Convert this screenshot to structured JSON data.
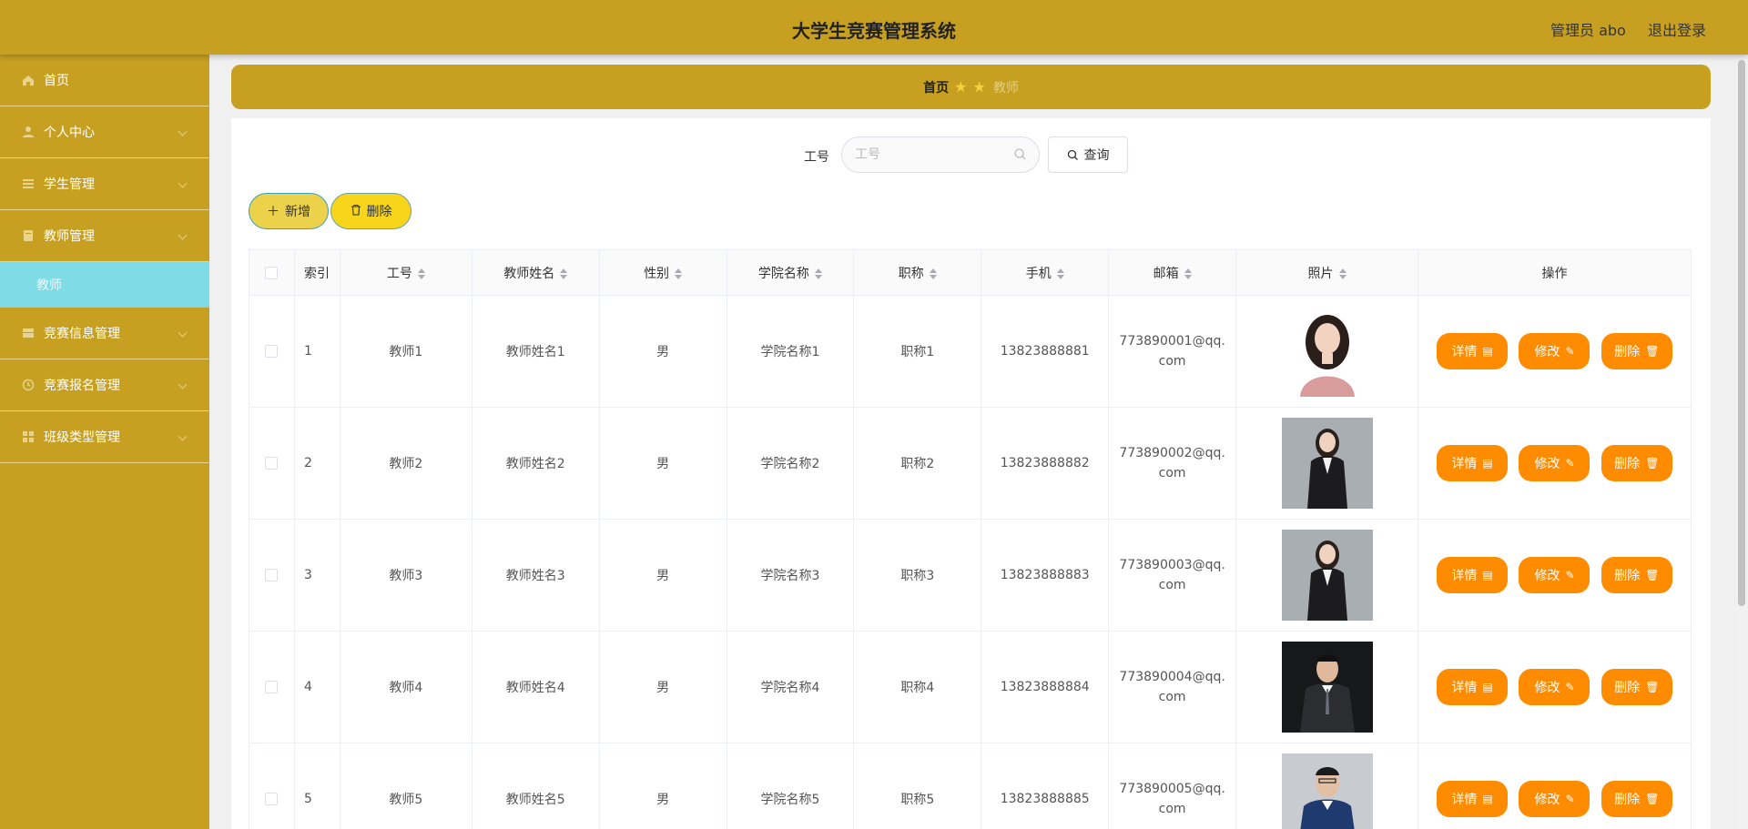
{
  "header": {
    "title": "大学生竞赛管理系统",
    "admin": "管理员 abo",
    "logout": "退出登录"
  },
  "sidebar": {
    "items": [
      {
        "label": "首页",
        "icon": "home-icon"
      },
      {
        "label": "个人中心",
        "icon": "user-icon"
      },
      {
        "label": "学生管理",
        "icon": "list-icon"
      },
      {
        "label": "教师管理",
        "icon": "book-icon"
      },
      {
        "label": "竞赛信息管理",
        "icon": "table-icon"
      },
      {
        "label": "竞赛报名管理",
        "icon": "clock-icon"
      },
      {
        "label": "班级类型管理",
        "icon": "grid-icon"
      }
    ],
    "sub_item": "教师"
  },
  "breadcrumb": {
    "home": "首页",
    "current": "教师"
  },
  "search": {
    "label": "工号",
    "placeholder": "工号",
    "button": "查询"
  },
  "actions": {
    "add": "新增",
    "delete": "删除"
  },
  "table": {
    "columns": [
      "索引",
      "工号",
      "教师姓名",
      "性别",
      "学院名称",
      "职称",
      "手机",
      "邮箱",
      "照片",
      "操作"
    ],
    "ops": {
      "detail": "详情",
      "edit": "修改",
      "delete": "删除"
    },
    "rows": [
      {
        "index": "1",
        "id": "教师1",
        "name": "教师姓名1",
        "gender": "男",
        "college": "学院名称1",
        "title": "职称1",
        "phone": "13823888881",
        "email": "773890001@qq.com",
        "photo": "female-pink"
      },
      {
        "index": "2",
        "id": "教师2",
        "name": "教师姓名2",
        "gender": "男",
        "college": "学院名称2",
        "title": "职称2",
        "phone": "13823888882",
        "email": "773890002@qq.com",
        "photo": "female-suit"
      },
      {
        "index": "3",
        "id": "教师3",
        "name": "教师姓名3",
        "gender": "男",
        "college": "学院名称3",
        "title": "职称3",
        "phone": "13823888883",
        "email": "773890003@qq.com",
        "photo": "female-suit"
      },
      {
        "index": "4",
        "id": "教师4",
        "name": "教师姓名4",
        "gender": "男",
        "college": "学院名称4",
        "title": "职称4",
        "phone": "13823888884",
        "email": "773890004@qq.com",
        "photo": "male-dark"
      },
      {
        "index": "5",
        "id": "教师5",
        "name": "教师姓名5",
        "gender": "男",
        "college": "学院名称5",
        "title": "职称5",
        "phone": "13823888885",
        "email": "773890005@qq.com",
        "photo": "male-blue"
      }
    ]
  },
  "colors": {
    "primary": "#c7a022",
    "accent": "#ff8c00",
    "sub_active": "#7fdbe6"
  }
}
